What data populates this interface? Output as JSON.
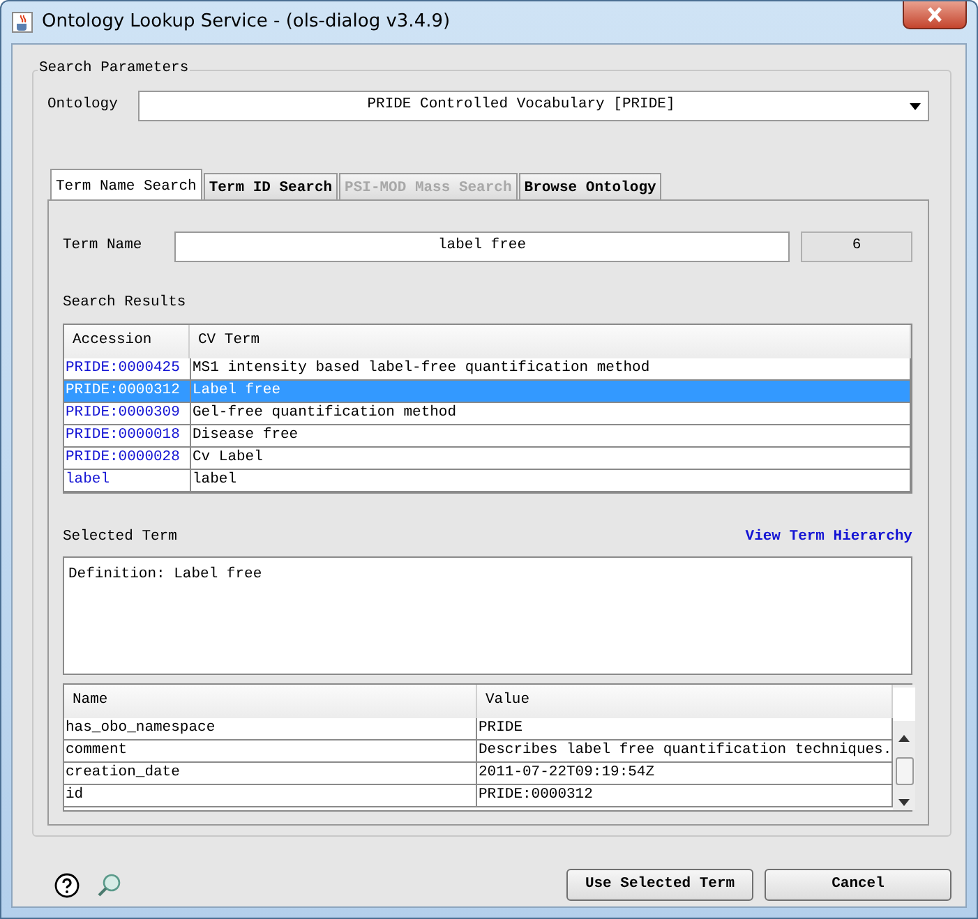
{
  "window": {
    "title": "Ontology Lookup Service - (ols-dialog v3.4.9)"
  },
  "search_parameters": {
    "legend": "Search Parameters",
    "ontology": {
      "label": "Ontology",
      "value": "PRIDE Controlled Vocabulary [PRIDE]"
    }
  },
  "tabs": [
    {
      "label": "Term Name Search",
      "selected": true,
      "disabled": false
    },
    {
      "label": "Term ID Search",
      "selected": false,
      "disabled": false
    },
    {
      "label": "PSI-MOD Mass Search",
      "selected": false,
      "disabled": true
    },
    {
      "label": "Browse Ontology",
      "selected": false,
      "disabled": false
    }
  ],
  "term_name": {
    "label": "Term Name",
    "value": "label free",
    "count": "6"
  },
  "search_results": {
    "label": "Search Results",
    "columns": [
      "Accession",
      "CV Term"
    ],
    "rows": [
      {
        "accession": "PRIDE:0000425",
        "cv_term": "MS1 intensity based label-free quantification method",
        "selected": false
      },
      {
        "accession": "PRIDE:0000312",
        "cv_term": "Label free",
        "selected": true
      },
      {
        "accession": "PRIDE:0000309",
        "cv_term": "Gel-free quantification method",
        "selected": false
      },
      {
        "accession": "PRIDE:0000018",
        "cv_term": "Disease free",
        "selected": false
      },
      {
        "accession": "PRIDE:0000028",
        "cv_term": "Cv Label",
        "selected": false
      },
      {
        "accession": "label",
        "cv_term": "label",
        "selected": false
      }
    ]
  },
  "selected_term": {
    "label": "Selected Term",
    "link": "View Term Hierarchy",
    "definition": "Definition: Label free"
  },
  "properties": {
    "columns": [
      "Name",
      "Value"
    ],
    "rows": [
      {
        "name": "has_obo_namespace",
        "value": "PRIDE"
      },
      {
        "name": "comment",
        "value": "Describes label free quantification techniques."
      },
      {
        "name": "creation_date",
        "value": "2011-07-22T09:19:54Z"
      },
      {
        "name": "id",
        "value": "PRIDE:0000312"
      }
    ]
  },
  "buttons": [
    "Use Selected Term",
    "Cancel"
  ]
}
